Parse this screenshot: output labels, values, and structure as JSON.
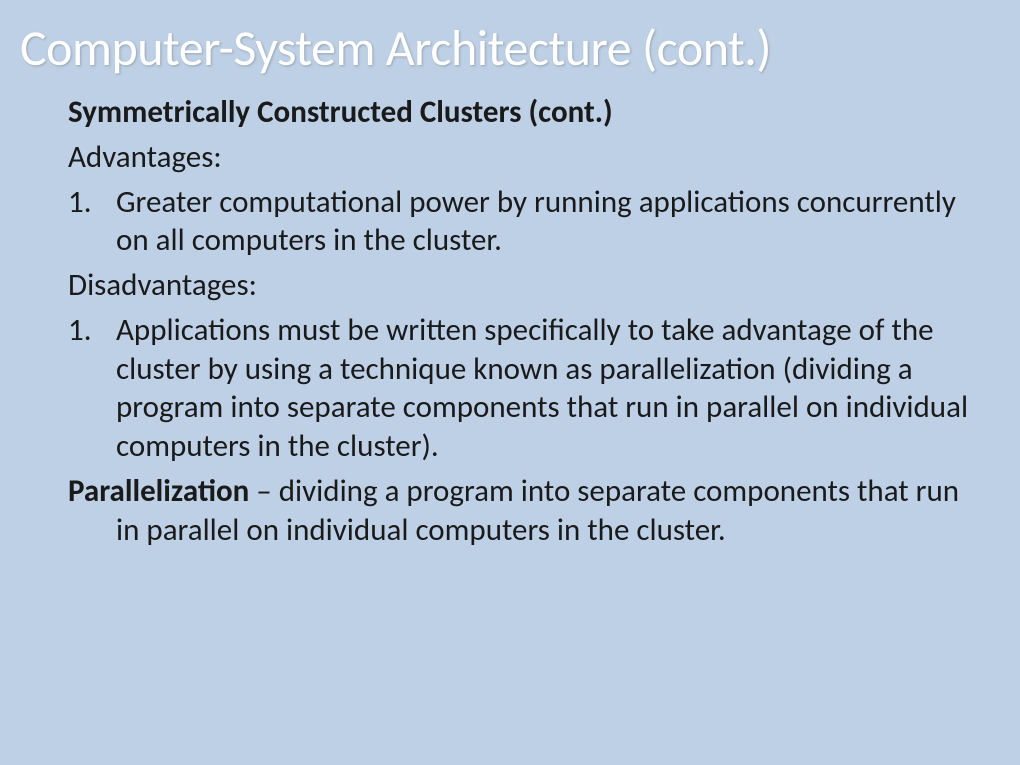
{
  "title": "Computer-System Architecture (cont.)",
  "subtitle": "Symmetrically Constructed Clusters (cont.)",
  "advantages_label": "Advantages:",
  "advantages": [
    {
      "number": "1.",
      "text": "Greater computational power by running applications concurrently on all computers in the cluster."
    }
  ],
  "disadvantages_label": "Disadvantages:",
  "disadvantages": [
    {
      "number": "1.",
      "text": "Applications must be written specifically to take advantage of the cluster by using a technique known as parallelization (dividing a program into separate components that run in parallel on individual computers in the cluster)."
    }
  ],
  "definition_term": "Parallelization",
  "definition_separator": " – ",
  "definition_text": "dividing a program into separate components that run in parallel on individual computers in the cluster."
}
